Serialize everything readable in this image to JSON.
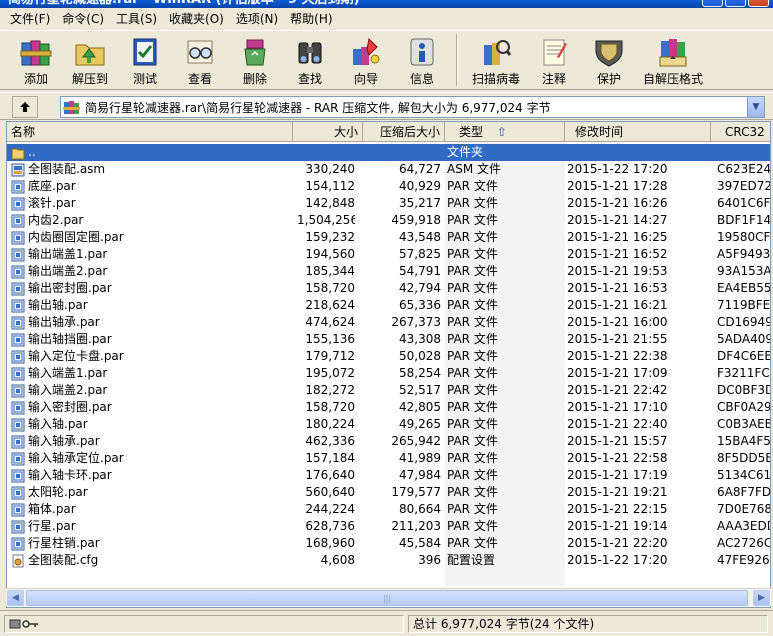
{
  "titlebar": {
    "title": "简易行星轮减速器.rar - WinRAR (评估版本 - 9 天后到期)"
  },
  "menu": [
    {
      "label": "文件(F)"
    },
    {
      "label": "命令(C)"
    },
    {
      "label": "工具(S)"
    },
    {
      "label": "收藏夹(O)"
    },
    {
      "label": "选项(N)"
    },
    {
      "label": "帮助(H)"
    }
  ],
  "toolbar": [
    {
      "label": "添加",
      "icon": "add-books-icon"
    },
    {
      "label": "解压到",
      "icon": "extract-folder-icon"
    },
    {
      "label": "测试",
      "icon": "test-checklist-icon"
    },
    {
      "label": "查看",
      "icon": "view-glasses-icon"
    },
    {
      "label": "删除",
      "icon": "delete-recycle-icon"
    },
    {
      "label": "查找",
      "icon": "find-binoculars-icon"
    },
    {
      "label": "向导",
      "icon": "wizard-icon"
    },
    {
      "label": "信息",
      "icon": "info-icon"
    },
    {
      "label": "扫描病毒",
      "icon": "virus-scan-icon"
    },
    {
      "label": "注释",
      "icon": "comment-notepad-icon"
    },
    {
      "label": "保护",
      "icon": "protect-shield-icon"
    },
    {
      "label": "自解压格式",
      "icon": "sfx-box-icon"
    }
  ],
  "address": {
    "path": "简易行星轮减速器.rar\\简易行星轮减速器 - RAR 压缩文件, 解包大小为 6,977,024 字节"
  },
  "columns": {
    "name": "名称",
    "size": "大小",
    "packed": "压缩后大小",
    "type": "类型",
    "modified": "修改时间",
    "crc": "CRC32"
  },
  "files": [
    {
      "name": "..",
      "size": "",
      "packed": "",
      "type": "文件夹",
      "modified": "",
      "crc": "",
      "icon": "folder-up-icon",
      "selected": true
    },
    {
      "name": "全图装配.asm",
      "size": "330,240",
      "packed": "64,727",
      "type": "ASM 文件",
      "modified": "2015-1-22 17:20",
      "crc": "C623E24",
      "icon": "file-asm-icon"
    },
    {
      "name": "底座.par",
      "size": "154,112",
      "packed": "40,929",
      "type": "PAR 文件",
      "modified": "2015-1-21 17:28",
      "crc": "397ED72",
      "icon": "file-par-icon"
    },
    {
      "name": "滚针.par",
      "size": "142,848",
      "packed": "35,217",
      "type": "PAR 文件",
      "modified": "2015-1-21 16:26",
      "crc": "6401C6F",
      "icon": "file-par-icon"
    },
    {
      "name": "内齿2.par",
      "size": "1,504,256",
      "packed": "459,918",
      "type": "PAR 文件",
      "modified": "2015-1-21 14:27",
      "crc": "BDF1F14",
      "icon": "file-par-icon"
    },
    {
      "name": "内齿圈固定圈.par",
      "size": "159,232",
      "packed": "43,548",
      "type": "PAR 文件",
      "modified": "2015-1-21 16:25",
      "crc": "19580CF",
      "icon": "file-par-icon"
    },
    {
      "name": "输出端盖1.par",
      "size": "194,560",
      "packed": "57,825",
      "type": "PAR 文件",
      "modified": "2015-1-21 16:52",
      "crc": "A5F9493",
      "icon": "file-par-icon"
    },
    {
      "name": "输出端盖2.par",
      "size": "185,344",
      "packed": "54,791",
      "type": "PAR 文件",
      "modified": "2015-1-21 19:53",
      "crc": "93A153A",
      "icon": "file-par-icon"
    },
    {
      "name": "输出密封圈.par",
      "size": "158,720",
      "packed": "42,794",
      "type": "PAR 文件",
      "modified": "2015-1-21 16:53",
      "crc": "EA4EB55",
      "icon": "file-par-icon"
    },
    {
      "name": "输出轴.par",
      "size": "218,624",
      "packed": "65,336",
      "type": "PAR 文件",
      "modified": "2015-1-21 16:21",
      "crc": "7119BFE",
      "icon": "file-par-icon"
    },
    {
      "name": "输出轴承.par",
      "size": "474,624",
      "packed": "267,373",
      "type": "PAR 文件",
      "modified": "2015-1-21 16:00",
      "crc": "CD16949",
      "icon": "file-par-icon"
    },
    {
      "name": "输出轴挡圈.par",
      "size": "155,136",
      "packed": "43,308",
      "type": "PAR 文件",
      "modified": "2015-1-21 21:55",
      "crc": "5ADA409",
      "icon": "file-par-icon"
    },
    {
      "name": "输入定位卡盘.par",
      "size": "179,712",
      "packed": "50,028",
      "type": "PAR 文件",
      "modified": "2015-1-21 22:38",
      "crc": "DF4C6EE",
      "icon": "file-par-icon"
    },
    {
      "name": "输入端盖1.par",
      "size": "195,072",
      "packed": "58,254",
      "type": "PAR 文件",
      "modified": "2015-1-21 17:09",
      "crc": "F3211FC",
      "icon": "file-par-icon"
    },
    {
      "name": "输入端盖2.par",
      "size": "182,272",
      "packed": "52,517",
      "type": "PAR 文件",
      "modified": "2015-1-21 22:42",
      "crc": "DC0BF3D",
      "icon": "file-par-icon"
    },
    {
      "name": "输入密封圈.par",
      "size": "158,720",
      "packed": "42,805",
      "type": "PAR 文件",
      "modified": "2015-1-21 17:10",
      "crc": "CBF0A29",
      "icon": "file-par-icon"
    },
    {
      "name": "输入轴.par",
      "size": "180,224",
      "packed": "49,265",
      "type": "PAR 文件",
      "modified": "2015-1-21 22:40",
      "crc": "C0B3AEB",
      "icon": "file-par-icon"
    },
    {
      "name": "输入轴承.par",
      "size": "462,336",
      "packed": "265,942",
      "type": "PAR 文件",
      "modified": "2015-1-21 15:57",
      "crc": "15BA4F5",
      "icon": "file-par-icon"
    },
    {
      "name": "输入轴承定位.par",
      "size": "157,184",
      "packed": "41,989",
      "type": "PAR 文件",
      "modified": "2015-1-21 22:58",
      "crc": "8F5DD5E",
      "icon": "file-par-icon"
    },
    {
      "name": "输入轴卡环.par",
      "size": "176,640",
      "packed": "47,984",
      "type": "PAR 文件",
      "modified": "2015-1-21 17:19",
      "crc": "5134C61",
      "icon": "file-par-icon"
    },
    {
      "name": "太阳轮.par",
      "size": "560,640",
      "packed": "179,577",
      "type": "PAR 文件",
      "modified": "2015-1-21 19:21",
      "crc": "6A8F7FD",
      "icon": "file-par-icon"
    },
    {
      "name": "箱体.par",
      "size": "244,224",
      "packed": "80,664",
      "type": "PAR 文件",
      "modified": "2015-1-21 22:15",
      "crc": "7D0E768",
      "icon": "file-par-icon"
    },
    {
      "name": "行星.par",
      "size": "628,736",
      "packed": "211,203",
      "type": "PAR 文件",
      "modified": "2015-1-21 19:14",
      "crc": "AAA3EDD",
      "icon": "file-par-icon"
    },
    {
      "name": "行星柱销.par",
      "size": "168,960",
      "packed": "45,584",
      "type": "PAR 文件",
      "modified": "2015-1-21 22:20",
      "crc": "AC2726C",
      "icon": "file-par-icon"
    },
    {
      "name": "全图装配.cfg",
      "size": "4,608",
      "packed": "396",
      "type": "配置设置",
      "modified": "2015-1-22 17:20",
      "crc": "47FE926",
      "icon": "file-cfg-icon"
    }
  ],
  "status": {
    "total": "总计 6,977,024 字节(24 个文件)"
  },
  "colors": {
    "selection": "#316ac5",
    "titlebar": "#0a5ed8",
    "chrome": "#ece9d8"
  }
}
